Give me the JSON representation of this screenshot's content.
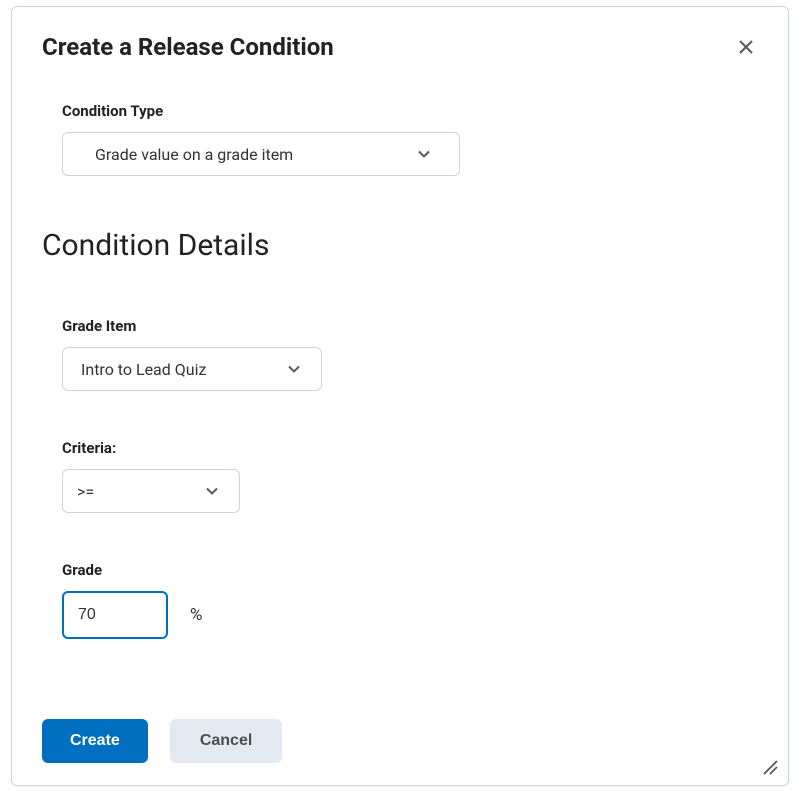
{
  "dialog": {
    "title": "Create a Release Condition"
  },
  "condition_type": {
    "label": "Condition Type",
    "selected": "Grade value on a grade item"
  },
  "details": {
    "heading": "Condition Details",
    "grade_item": {
      "label": "Grade Item",
      "selected": "Intro to Lead Quiz"
    },
    "criteria": {
      "label": "Criteria:",
      "selected": ">="
    },
    "grade": {
      "label": "Grade",
      "value": "70",
      "suffix": "%"
    }
  },
  "footer": {
    "create": "Create",
    "cancel": "Cancel"
  }
}
